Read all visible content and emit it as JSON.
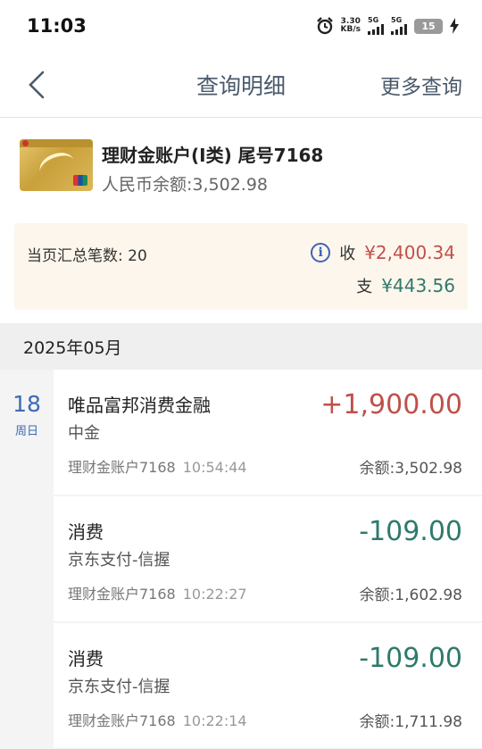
{
  "status_bar": {
    "time": "11:03",
    "net_speed_value": "3.30",
    "net_speed_unit": "KB/s",
    "signal1_label": "5G",
    "signal2_label": "5G",
    "battery": "15"
  },
  "header": {
    "back_icon": "chevron-left-icon",
    "title": "查询明细",
    "more_label": "更多查询"
  },
  "account": {
    "name": "理财金账户(Ⅰ类) 尾号7168",
    "balance": "人民币余额:3,502.98"
  },
  "summary": {
    "count": "当页汇总笔数: 20",
    "income_label": "收",
    "income": "¥2,400.34",
    "expense_label": "支",
    "expense": "¥443.56"
  },
  "month": "2025年05月",
  "day": {
    "num": "18",
    "week": "周日"
  },
  "transactions": [
    {
      "title": "唯品富邦消费金融",
      "sub": "中金",
      "acct": "理财金账户7168",
      "time": "10:54:44",
      "amount": "+1,900.00",
      "balance": "余额:3,502.98",
      "type": "income"
    },
    {
      "title": "消费",
      "sub": "京东支付-信握",
      "acct": "理财金账户7168",
      "time": "10:22:27",
      "amount": "-109.00",
      "balance": "余额:1,602.98",
      "type": "expense"
    },
    {
      "title": "消费",
      "sub": "京东支付-信握",
      "acct": "理财金账户7168",
      "time": "10:22:14",
      "amount": "-109.00",
      "balance": "余额:1,711.98",
      "type": "expense"
    }
  ],
  "colors": {
    "income": "#c0504a",
    "expense": "#2e7a6c",
    "accent": "#3c6bb5",
    "summary_bg": "#fdf6ec"
  }
}
